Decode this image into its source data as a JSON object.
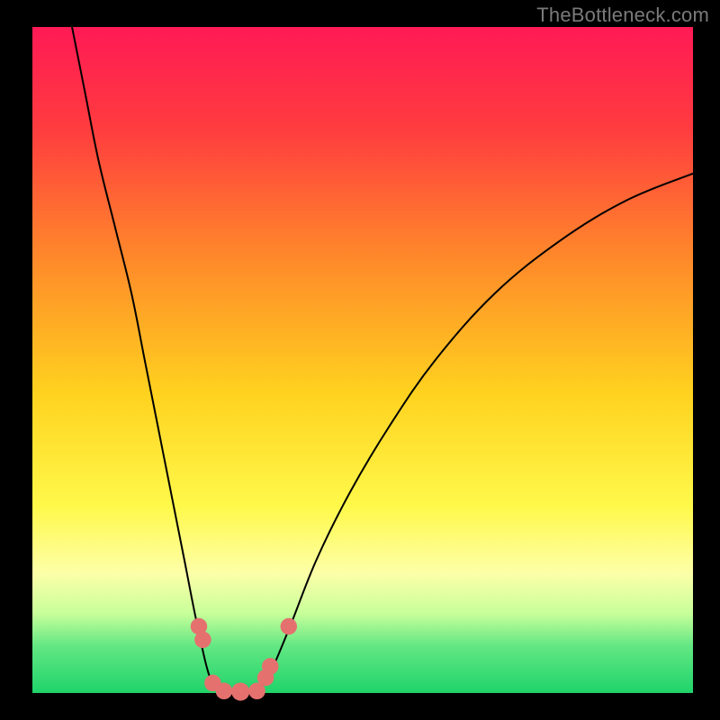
{
  "watermark": "TheBottleneck.com",
  "chart_data": {
    "type": "line",
    "title": "",
    "xlabel": "",
    "ylabel": "",
    "xlim": [
      0,
      100
    ],
    "ylim": [
      0,
      100
    ],
    "background_gradient": {
      "stops": [
        {
          "offset": 0.0,
          "color": "#ff1a55"
        },
        {
          "offset": 0.15,
          "color": "#ff3b3f"
        },
        {
          "offset": 0.35,
          "color": "#ff8a2a"
        },
        {
          "offset": 0.55,
          "color": "#ffd21f"
        },
        {
          "offset": 0.72,
          "color": "#fff94a"
        },
        {
          "offset": 0.82,
          "color": "#fdffa8"
        },
        {
          "offset": 0.88,
          "color": "#c8ff9a"
        },
        {
          "offset": 0.93,
          "color": "#62e783"
        },
        {
          "offset": 1.0,
          "color": "#1fd36a"
        }
      ]
    },
    "series": [
      {
        "name": "left-curve",
        "type": "line",
        "points": [
          {
            "x": 6.0,
            "y": 100.0
          },
          {
            "x": 8.0,
            "y": 90.0
          },
          {
            "x": 10.0,
            "y": 80.0
          },
          {
            "x": 12.5,
            "y": 70.0
          },
          {
            "x": 15.0,
            "y": 60.0
          },
          {
            "x": 17.0,
            "y": 50.0
          },
          {
            "x": 19.0,
            "y": 40.0
          },
          {
            "x": 21.0,
            "y": 30.0
          },
          {
            "x": 23.0,
            "y": 20.0
          },
          {
            "x": 25.0,
            "y": 10.0
          },
          {
            "x": 27.0,
            "y": 2.0
          },
          {
            "x": 29.0,
            "y": 0.0
          }
        ]
      },
      {
        "name": "valley-floor",
        "type": "line",
        "points": [
          {
            "x": 29.0,
            "y": 0.0
          },
          {
            "x": 34.0,
            "y": 0.0
          }
        ]
      },
      {
        "name": "right-curve",
        "type": "line",
        "points": [
          {
            "x": 34.0,
            "y": 0.0
          },
          {
            "x": 36.0,
            "y": 3.0
          },
          {
            "x": 39.0,
            "y": 10.0
          },
          {
            "x": 43.0,
            "y": 20.0
          },
          {
            "x": 48.0,
            "y": 30.0
          },
          {
            "x": 54.0,
            "y": 40.0
          },
          {
            "x": 61.0,
            "y": 50.0
          },
          {
            "x": 70.0,
            "y": 60.0
          },
          {
            "x": 80.0,
            "y": 68.0
          },
          {
            "x": 90.0,
            "y": 74.0
          },
          {
            "x": 100.0,
            "y": 78.0
          }
        ]
      }
    ],
    "markers": [
      {
        "x": 25.2,
        "y": 10.0,
        "r": 1.3
      },
      {
        "x": 25.8,
        "y": 8.0,
        "r": 1.3
      },
      {
        "x": 27.3,
        "y": 1.5,
        "r": 1.3
      },
      {
        "x": 29.0,
        "y": 0.3,
        "r": 1.3
      },
      {
        "x": 31.5,
        "y": 0.2,
        "r": 1.5
      },
      {
        "x": 34.0,
        "y": 0.3,
        "r": 1.3
      },
      {
        "x": 35.3,
        "y": 2.3,
        "r": 1.3
      },
      {
        "x": 36.0,
        "y": 4.0,
        "r": 1.3
      },
      {
        "x": 38.8,
        "y": 10.0,
        "r": 1.3
      }
    ],
    "marker_color": "#e5716f",
    "curve_color": "#000000",
    "curve_width": 2.0
  }
}
